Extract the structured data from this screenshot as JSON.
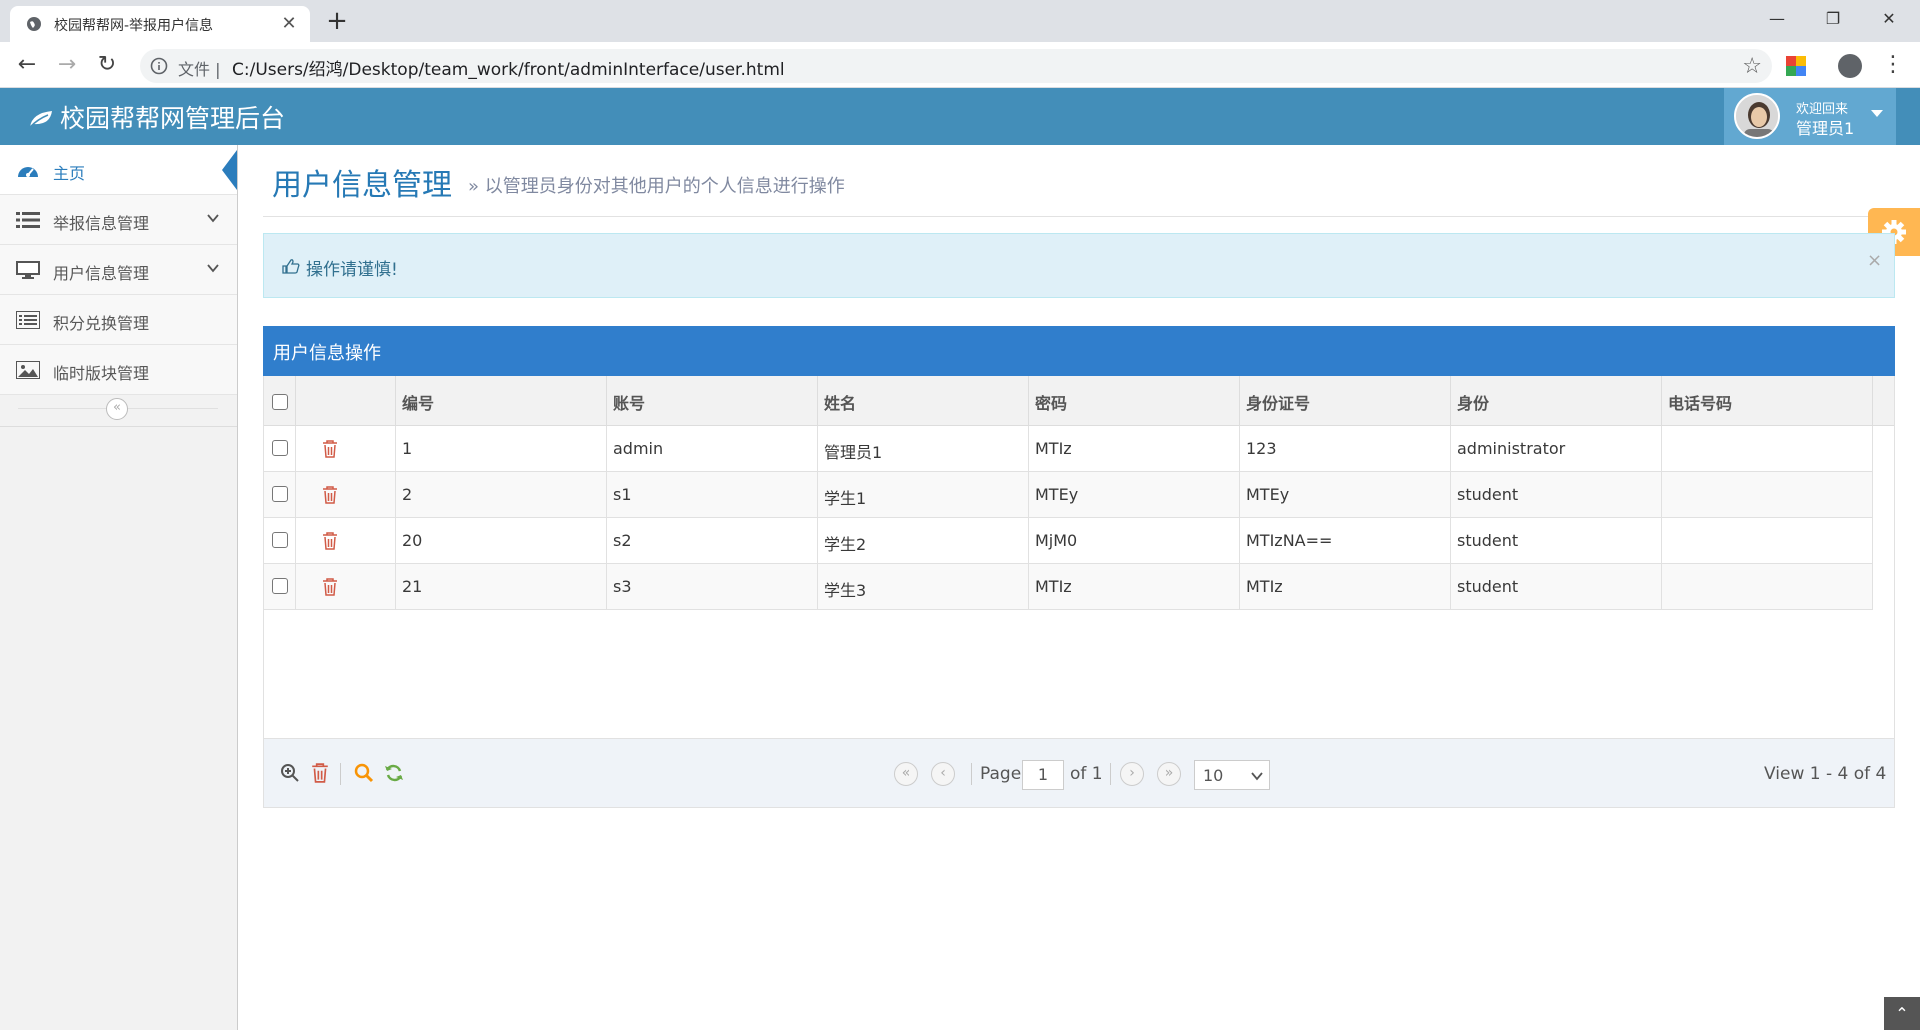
{
  "browser": {
    "tab_title": "校园帮帮网-举报用户信息",
    "tab_close": "✕",
    "new_tab": "+",
    "omnibox_scheme": "文件 |",
    "url": "C:/Users/绍鸿/Desktop/team_work/front/adminInterface/user.html",
    "back": "←",
    "forward": "→",
    "reload": "↻",
    "star": "☆",
    "menu": "⋮",
    "minimize": "—",
    "maximize": "❐",
    "close": "✕"
  },
  "header": {
    "brand": "校园帮帮网管理后台",
    "welcome": "欢迎回来",
    "username": "管理员1",
    "color": "#438eb9"
  },
  "sidebar": {
    "items": [
      {
        "label": "主页",
        "icon": "dashboard-icon"
      },
      {
        "label": "举报信息管理",
        "icon": "list-icon"
      },
      {
        "label": "用户信息管理",
        "icon": "desktop-icon"
      },
      {
        "label": "积分兑换管理",
        "icon": "list-alt-icon"
      },
      {
        "label": "临时版块管理",
        "icon": "picture-icon"
      }
    ],
    "collapse": "«"
  },
  "main": {
    "title": "用户信息管理",
    "subtitle": "» 以管理员身份对其他用户的个人信息进行操作",
    "alert": "操作请谨慎!",
    "alert_close": "×",
    "grid_title": "用户信息操作",
    "columns": [
      "编号",
      "账号",
      "姓名",
      "密码",
      "身份证号",
      "身份",
      "电话号码"
    ],
    "rows": [
      {
        "id": "1",
        "account": "admin",
        "name": "管理员1",
        "password": "MTIz",
        "idcard": "123",
        "role": "administrator",
        "phone": ""
      },
      {
        "id": "2",
        "account": "s1",
        "name": "学生1",
        "password": "MTEy",
        "idcard": "MTEy",
        "role": "student",
        "phone": ""
      },
      {
        "id": "20",
        "account": "s2",
        "name": "学生2",
        "password": "MjM0",
        "idcard": "MTIzNA==",
        "role": "student",
        "phone": ""
      },
      {
        "id": "21",
        "account": "s3",
        "name": "学生3",
        "password": "MTIz",
        "idcard": "MTIz",
        "role": "student",
        "phone": ""
      }
    ]
  },
  "pager": {
    "page_label": "Page",
    "page_value": "1",
    "of_label": "of 1",
    "rows_per_page": "10",
    "view": "View 1 - 4 of 4",
    "first": "«",
    "prev": "‹",
    "next": "›",
    "last": "»"
  },
  "back_top": "⌃"
}
